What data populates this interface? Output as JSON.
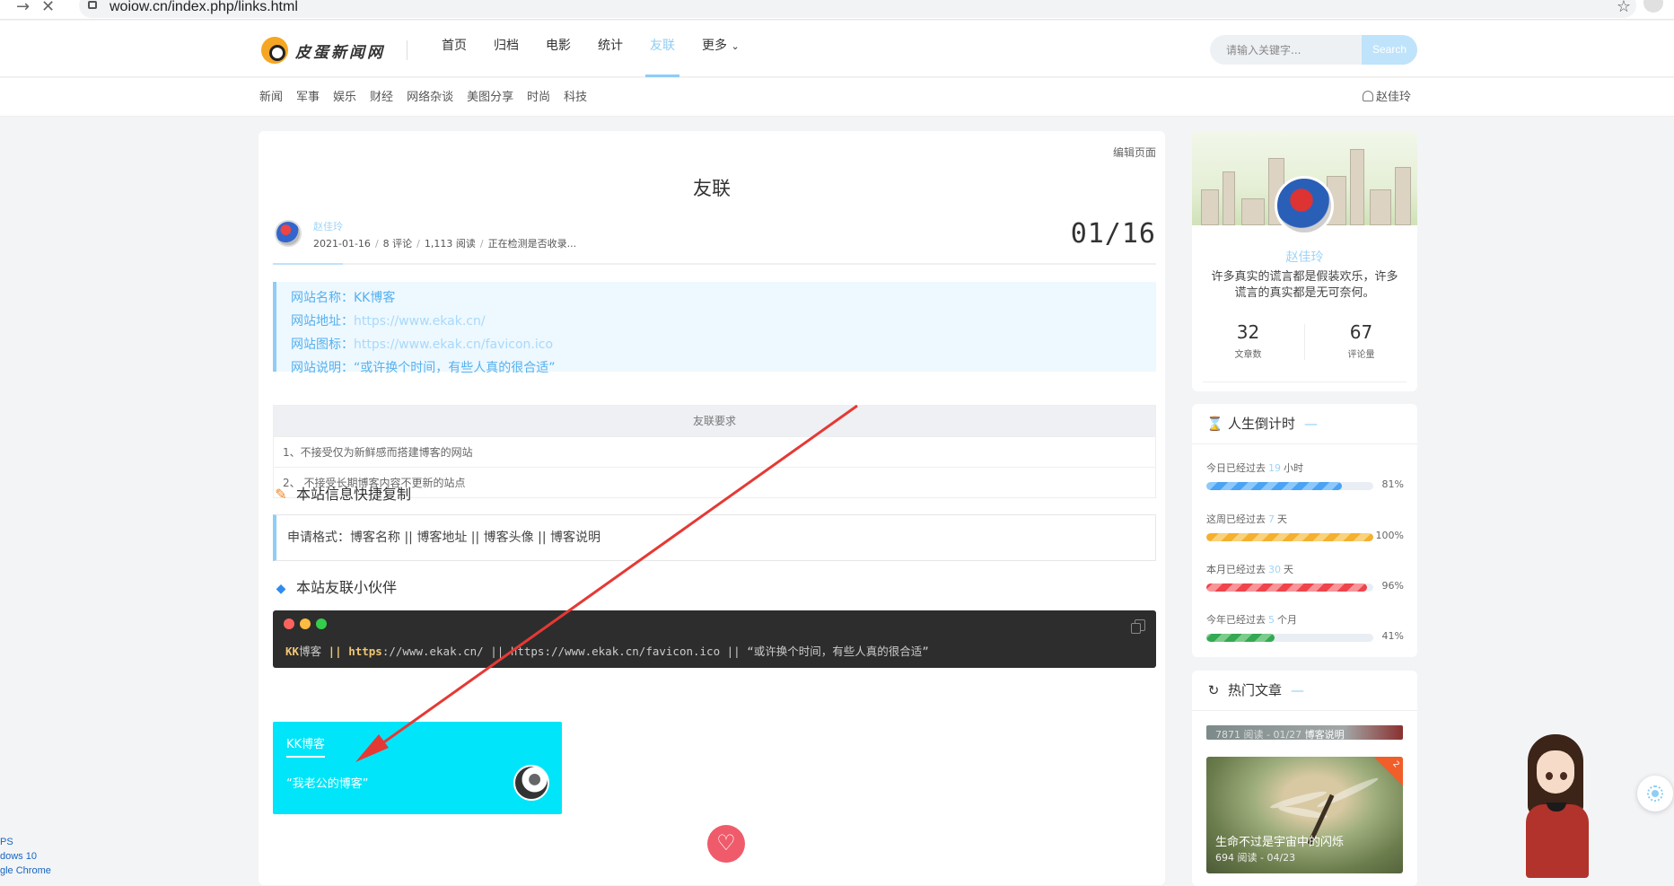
{
  "browser": {
    "url": "woiow.cn/index.php/links.html"
  },
  "site": {
    "logo_text": "皮蛋新闻网",
    "nav": [
      "首页",
      "归档",
      "电影",
      "统计",
      "友联",
      "更多"
    ],
    "nav_active_index": 4,
    "search_placeholder": "请输入关键字...",
    "search_button": "Search",
    "categories": [
      "新闻",
      "军事",
      "娱乐",
      "财经",
      "网络杂谈",
      "美图分享",
      "时尚",
      "科技"
    ],
    "user_name": "赵佳玲"
  },
  "page": {
    "edit_link": "编辑页面",
    "title": "友联",
    "author": "赵佳玲",
    "date": "2021-01-16",
    "comments": "8 评论",
    "reads": "1,113 阅读",
    "index_status": "正在检测是否收录...",
    "big_date": "01/16",
    "info": [
      {
        "label": "网站名称：",
        "value": "KK博客"
      },
      {
        "label": "网站地址：",
        "value": "https://www.ekak.cn/"
      },
      {
        "label": "网站图标：",
        "value": "https://www.ekak.cn/favicon.ico"
      },
      {
        "label": "网站说明：",
        "value": "“或许换个时间，有些人真的很合适”"
      }
    ],
    "requirements": {
      "header": "友联要求",
      "rows": [
        "1、不接受仅为新鲜感而搭建博客的网站",
        "2、 不接受长期博客内容不更新的站点"
      ]
    },
    "apply_format": "申请格式：博客名称 || 博客地址 || 博客头像 || 博客说明",
    "copy_section_title": "本站信息快捷复制",
    "code": {
      "kk": "KK",
      "name_rest": "博客",
      "bars1": " || ",
      "https": "https",
      "rest": "://www.ekak.cn/ || https://www.ekak.cn/favicon.ico || “或许换个时间，有些人真的很合适”"
    },
    "partners_title": "本站友联小伙伴",
    "friend": {
      "name": "KK博客",
      "desc": "“我老公的博客”"
    },
    "like_icon": "heart-icon"
  },
  "sidebar": {
    "profile": {
      "name": "赵佳玲",
      "bio": "许多真实的谎言都是假装欢乐，许多谎言的真实都是无可奈何。",
      "posts": "32",
      "posts_label": "文章数",
      "comments": "67",
      "comments_label": "评论量"
    },
    "countdown": {
      "title": "人生倒计时",
      "dash": "—",
      "items": [
        {
          "prefix": "今日已经过去",
          "num": "19",
          "unit": "小时",
          "pct": "81%",
          "fill": 0.81
        },
        {
          "prefix": "这周已经过去",
          "num": "7",
          "unit": "天",
          "pct": "100%",
          "fill": 1.0
        },
        {
          "prefix": "本月已经过去",
          "num": "30",
          "unit": "天",
          "pct": "96%",
          "fill": 0.96
        },
        {
          "prefix": "今年已经过去",
          "num": "5",
          "unit": "个月",
          "pct": "41%",
          "fill": 0.41
        }
      ]
    },
    "hot": {
      "title": "热门文章",
      "dash": "—",
      "item1_title": "博客说明",
      "item1_meta": "7871 阅读 - 01/27",
      "item2_title": "生命不过是宇宙中的闪烁",
      "item2_meta": "694 阅读 - 04/23",
      "item2_rank": "2"
    }
  },
  "os_info": [
    "PS",
    "dows 10",
    "gle Chrome"
  ],
  "colors": {
    "accent": "#8ecdf7",
    "friend_card": "#00e5f9",
    "arrow": "#e53935",
    "like": "#ef5b6b"
  }
}
